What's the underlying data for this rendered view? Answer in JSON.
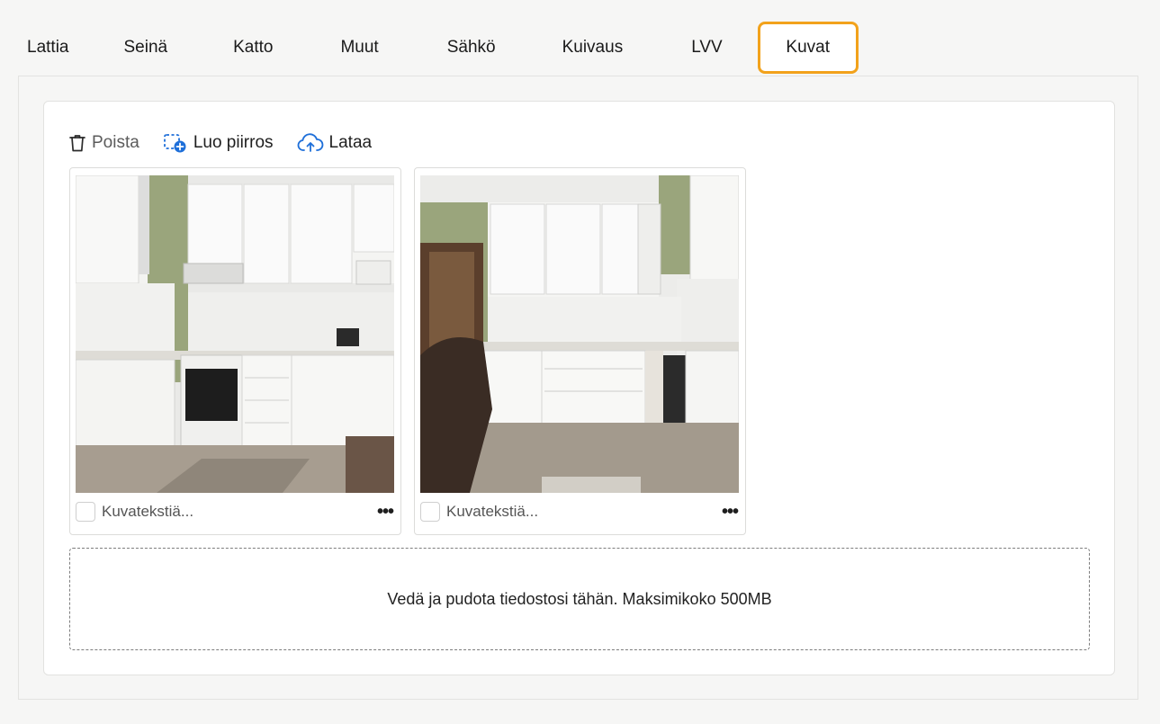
{
  "tabs": [
    {
      "label": "Lattia",
      "active": false
    },
    {
      "label": "Seinä",
      "active": false
    },
    {
      "label": "Katto",
      "active": false
    },
    {
      "label": "Muut",
      "active": false
    },
    {
      "label": "Sähkö",
      "active": false
    },
    {
      "label": "Kuivaus",
      "active": false
    },
    {
      "label": "LVV",
      "active": false
    },
    {
      "label": "Kuvat",
      "active": true
    }
  ],
  "toolbar": {
    "delete_label": "Poista",
    "draw_label": "Luo piirros",
    "upload_label": "Lataa"
  },
  "images": [
    {
      "caption_placeholder": "Kuvatekstiä...",
      "more_label": "•••"
    },
    {
      "caption_placeholder": "Kuvatekstiä...",
      "more_label": "•••"
    }
  ],
  "dropzone": {
    "text": "Vedä ja pudota tiedostosi tähän. Maksimikoko 500MB"
  },
  "colors": {
    "active_tab_border": "#f2a21b",
    "accent_blue": "#1e6fd9",
    "background": "#f6f6f5"
  }
}
